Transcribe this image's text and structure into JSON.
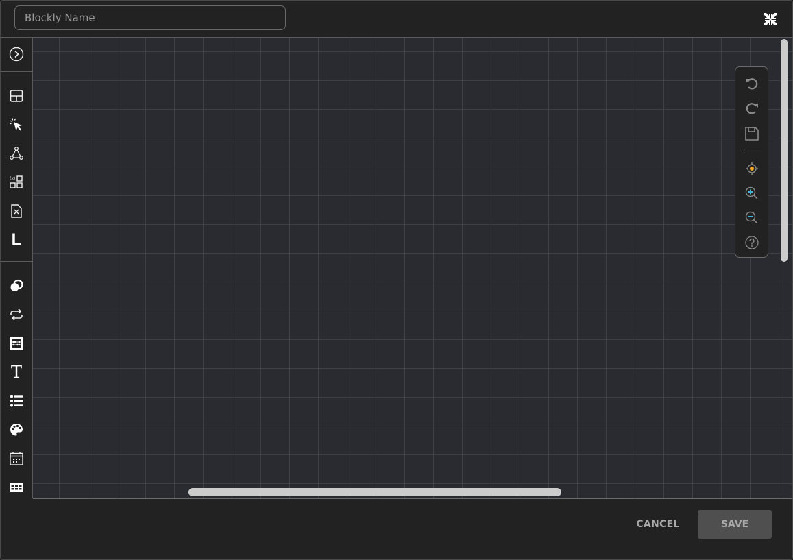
{
  "header": {
    "name_input": {
      "value": "",
      "placeholder": "Blockly Name"
    },
    "fullscreen_icon": "exit-fullscreen-icon"
  },
  "toolbox": {
    "toggle_icon": "chevron-right-circle-icon",
    "groups": [
      {
        "items": [
          {
            "icon": "layout-icon"
          },
          {
            "icon": "pointer-click-icon"
          },
          {
            "icon": "triangle-nodes-icon"
          },
          {
            "icon": "variables-grid-icon"
          },
          {
            "icon": "file-x-icon"
          },
          {
            "icon": "letter-l-icon",
            "text": "L"
          }
        ]
      },
      {
        "items": [
          {
            "icon": "logic-rings-icon"
          },
          {
            "icon": "loop-arrows-icon"
          },
          {
            "icon": "math-abacus-icon"
          },
          {
            "icon": "text-t-icon",
            "text": "T"
          },
          {
            "icon": "list-icon"
          },
          {
            "icon": "palette-icon"
          },
          {
            "icon": "calendar-icon"
          },
          {
            "icon": "table-icon"
          }
        ]
      }
    ]
  },
  "workspace_controls": {
    "undo": "undo-icon",
    "redo": "redo-icon",
    "save": "save-icon",
    "center": "center-target-icon",
    "zoom_in": "zoom-in-icon",
    "zoom_out": "zoom-out-icon",
    "help": "help-icon",
    "colors": {
      "center_dot": "#f5a623",
      "zoom_accent": "#3fb2e0",
      "stroke": "#8a8a8a"
    }
  },
  "footer": {
    "cancel_label": "CANCEL",
    "save_label": "SAVE"
  }
}
